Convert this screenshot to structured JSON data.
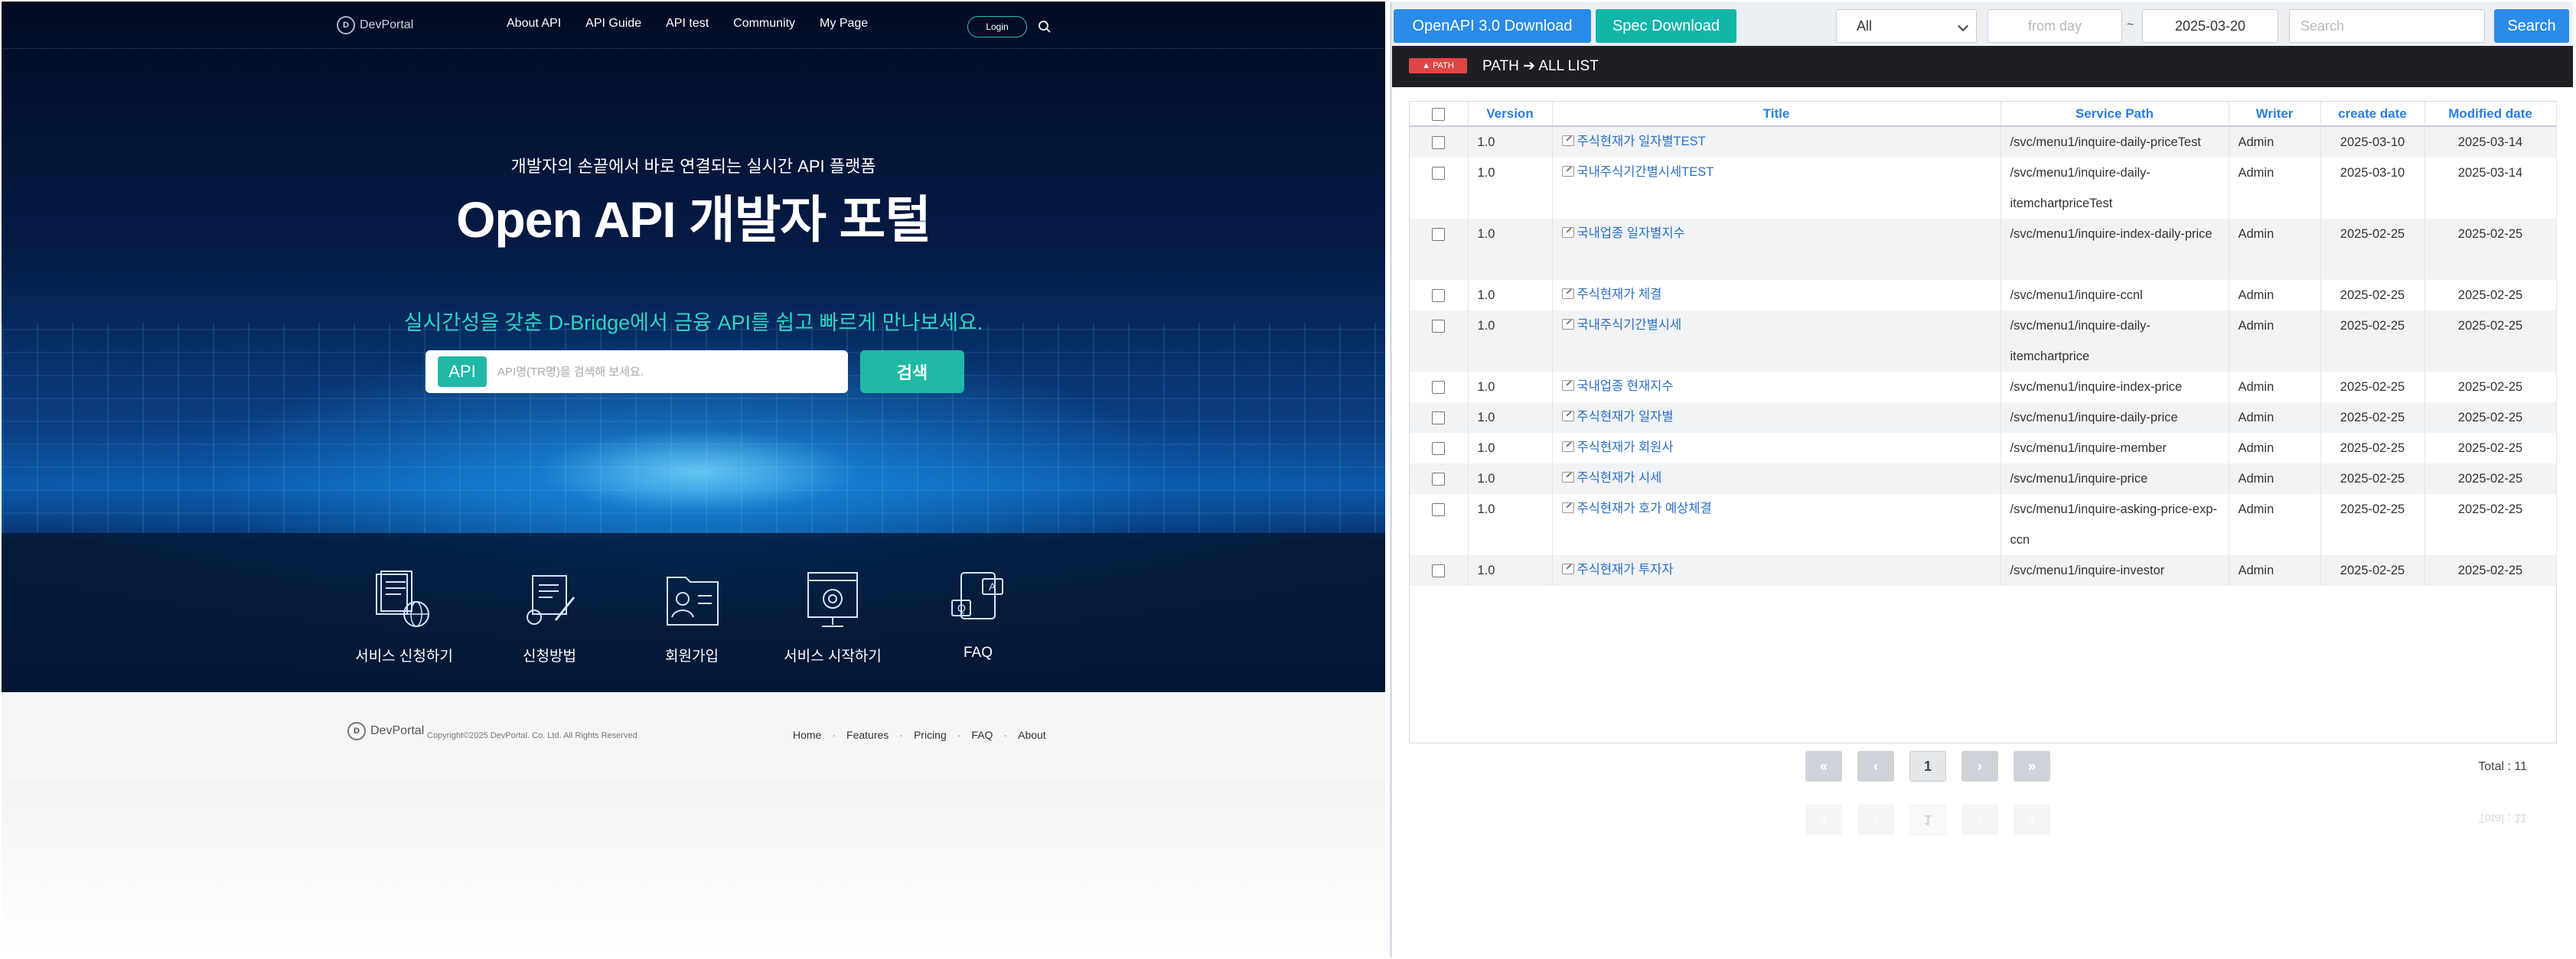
{
  "portal": {
    "nav": {
      "logo": "DevPortal",
      "links": [
        "About API",
        "API Guide",
        "API test",
        "Community",
        "My Page"
      ],
      "login": "Login"
    },
    "hero": {
      "subtitle": "개발자의 손끝에서 바로 연결되는 실시간 API 플랫폼",
      "title": "Open API 개발자 포털",
      "tagline": "실시간성을 갖춘 D-Bridge에서 금융 API를 쉽고 빠르게 만나보세요.",
      "search_tag": "API",
      "search_placeholder": "API명(TR명)을 검색해 보세요.",
      "search_button": "검색"
    },
    "services": [
      "서비스 신청하기",
      "신청방법",
      "회원가입",
      "서비스 시작하기",
      "FAQ"
    ],
    "footer": {
      "logo": "DevPortal",
      "copyright": "Copyright©2025 DevPortal. Co. Ltd. All Rights Reserved",
      "links": [
        "Home",
        "Features",
        "Pricing",
        "FAQ",
        "About"
      ]
    },
    "accent": "#1fb9a6"
  },
  "api_list": {
    "toolbar": {
      "openapi_download": "OpenAPI 3.0 Download",
      "spec_download": "Spec Download",
      "filter_selected": "All",
      "from_placeholder": "from day",
      "range_sep": "~",
      "to_date": "2025-03-20",
      "search_placeholder": "Search",
      "search_button": "Search"
    },
    "path": {
      "badge": "PATH",
      "text": "PATH ➔ ALL LIST"
    },
    "columns": [
      "Version",
      "Title",
      "Service Path",
      "Writer",
      "create date",
      "Modified date"
    ],
    "rows": [
      {
        "version": "1.0",
        "title": "주식현재가 일자별TEST",
        "path": "/svc/menu1/inquire-daily-priceTest",
        "writer": "Admin",
        "created": "2025-03-10",
        "modified": "2025-03-14"
      },
      {
        "version": "1.0",
        "title": "국내주식기간별시세TEST",
        "path": "/svc/menu1/inquire-daily-itemchartpriceTest",
        "writer": "Admin",
        "created": "2025-03-10",
        "modified": "2025-03-14"
      },
      {
        "version": "1.0",
        "title": "국내업종 일자별지수",
        "path": "/svc/menu1/inquire-index-daily-price",
        "writer": "Admin",
        "created": "2025-02-25",
        "modified": "2025-02-25"
      },
      {
        "version": "1.0",
        "title": "주식현재가 체결",
        "path": "/svc/menu1/inquire-ccnl",
        "writer": "Admin",
        "created": "2025-02-25",
        "modified": "2025-02-25"
      },
      {
        "version": "1.0",
        "title": "국내주식기간별시세",
        "path": "/svc/menu1/inquire-daily-itemchartprice",
        "writer": "Admin",
        "created": "2025-02-25",
        "modified": "2025-02-25"
      },
      {
        "version": "1.0",
        "title": "국내업종 현재지수",
        "path": "/svc/menu1/inquire-index-price",
        "writer": "Admin",
        "created": "2025-02-25",
        "modified": "2025-02-25"
      },
      {
        "version": "1.0",
        "title": "주식현재가 일자별",
        "path": "/svc/menu1/inquire-daily-price",
        "writer": "Admin",
        "created": "2025-02-25",
        "modified": "2025-02-25"
      },
      {
        "version": "1.0",
        "title": "주식현재가 회원사",
        "path": "/svc/menu1/inquire-member",
        "writer": "Admin",
        "created": "2025-02-25",
        "modified": "2025-02-25"
      },
      {
        "version": "1.0",
        "title": "주식현재가 시세",
        "path": "/svc/menu1/inquire-price",
        "writer": "Admin",
        "created": "2025-02-25",
        "modified": "2025-02-25"
      },
      {
        "version": "1.0",
        "title": "주식현재가 호가 예상체결",
        "path": "/svc/menu1/inquire-asking-price-exp-ccn",
        "writer": "Admin",
        "created": "2025-02-25",
        "modified": "2025-02-25"
      },
      {
        "version": "1.0",
        "title": "주식현재가 투자자",
        "path": "/svc/menu1/inquire-investor",
        "writer": "Admin",
        "created": "2025-02-25",
        "modified": "2025-02-25"
      }
    ],
    "pagination": {
      "current_page": "1",
      "total": "Total : 11"
    },
    "colors": {
      "primary": "#2b8be8",
      "teal": "#12b5a8",
      "header_text": "#2b7de0"
    }
  }
}
